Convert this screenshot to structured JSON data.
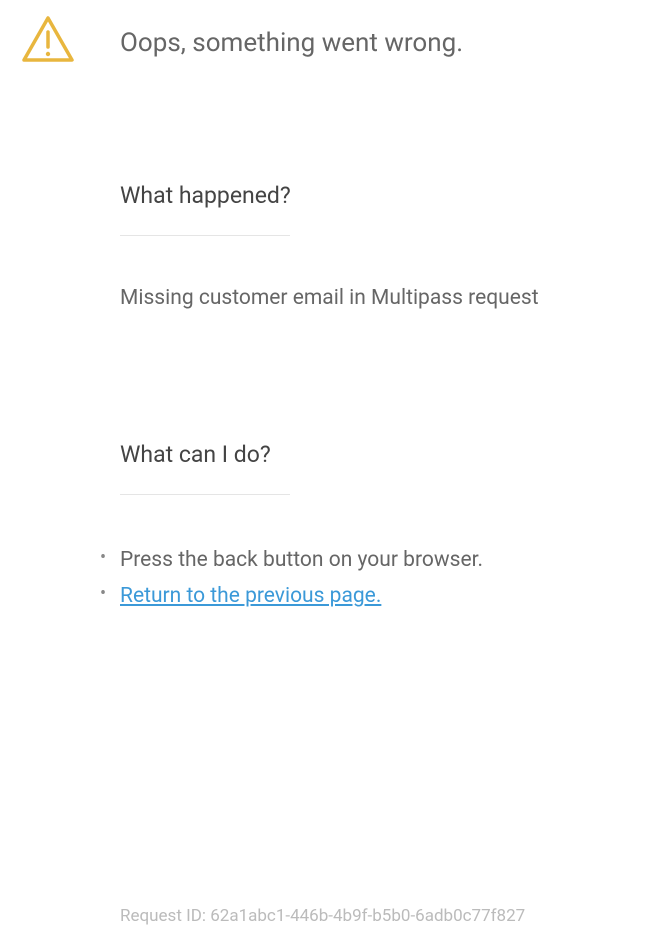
{
  "header": {
    "title": "Oops, something went wrong."
  },
  "what_happened": {
    "heading": "What happened?",
    "message": "Missing customer email in Multipass request"
  },
  "what_can_i_do": {
    "heading": "What can I do?",
    "items": [
      "Press the back button on your browser.",
      "Return to the previous page."
    ]
  },
  "footer": {
    "request_id_label": "Request ID: ",
    "request_id_value": "62a1abc1-446b-4b9f-b5b0-6adb0c77f827"
  }
}
